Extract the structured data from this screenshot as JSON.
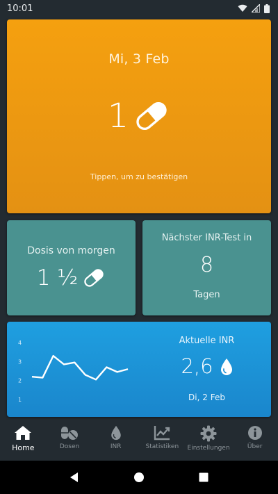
{
  "status_bar": {
    "time": "10:01"
  },
  "today_card": {
    "date": "Mi, 3 Feb",
    "dose": "1",
    "hint": "Tippen, um zu bestätigen",
    "color": "#f5a00f"
  },
  "tomorrow_card": {
    "label": "Dosis von morgen",
    "dose": "1 ½",
    "color": "#4a9290"
  },
  "inr_test_card": {
    "label": "Nächster INR-Test in",
    "days": "8",
    "unit": "Tagen",
    "color": "#4a9290"
  },
  "inr_card": {
    "label": "Aktuelle INR",
    "value": "2,6",
    "date": "Di, 2 Feb",
    "color": "#1f9fe0"
  },
  "chart_data": {
    "type": "line",
    "y_ticks": [
      "4",
      "3",
      "2",
      "1"
    ],
    "ylim": [
      1,
      4
    ],
    "values": [
      2.2,
      2.15,
      3.3,
      2.85,
      2.95,
      2.3,
      2.05,
      2.7,
      2.45,
      2.6
    ],
    "grid": false
  },
  "bottom_nav": {
    "items": [
      {
        "label": "Home",
        "icon": "home-icon",
        "active": true
      },
      {
        "label": "Dosen",
        "icon": "pills-icon",
        "active": false
      },
      {
        "label": "INR",
        "icon": "drop-icon",
        "active": false
      },
      {
        "label": "Statistiken",
        "icon": "chart-icon",
        "active": false
      },
      {
        "label": "Einstellungen",
        "icon": "gear-icon",
        "active": false
      },
      {
        "label": "Über",
        "icon": "info-icon",
        "active": false
      }
    ]
  }
}
